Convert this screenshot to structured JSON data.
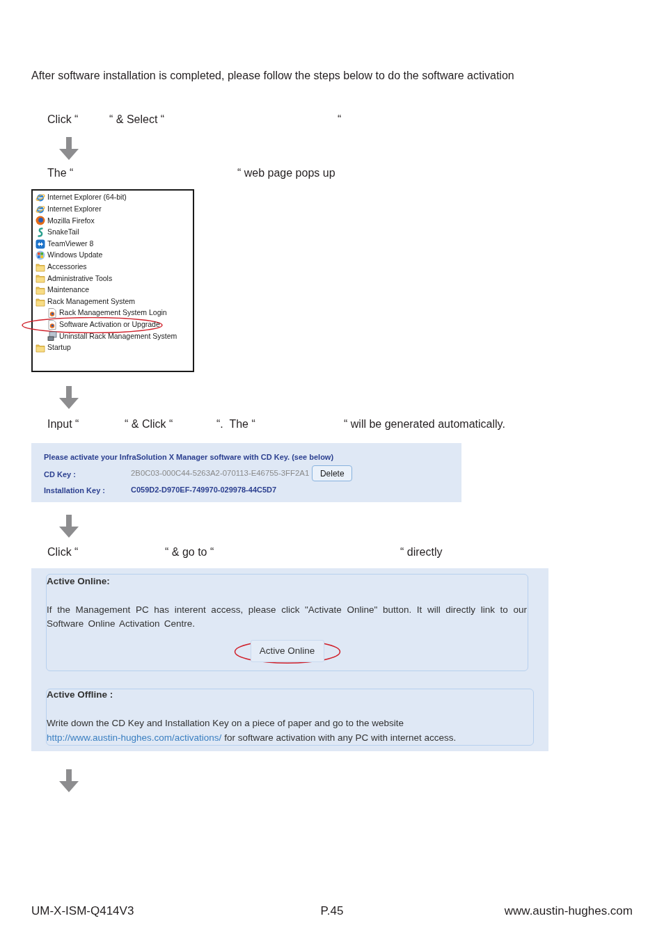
{
  "intro": "After software installation is completed, please follow the steps below to do the software activation",
  "blocks": [
    {
      "kind": "step",
      "parts": [
        "Click “",
        "“ & Select “",
        "“"
      ]
    },
    {
      "kind": "arrow"
    },
    {
      "kind": "step",
      "parts": [
        "The “",
        "“ web page pops up"
      ]
    },
    {
      "kind": "start_menu",
      "items": [
        {
          "label": "Internet Explorer (64-bit)",
          "kind": "program",
          "highlighted": false
        },
        {
          "label": "Internet Explorer",
          "kind": "program",
          "highlighted": false
        },
        {
          "label": "Mozilla Firefox",
          "kind": "program",
          "highlighted": false
        },
        {
          "label": "SnakeTail",
          "kind": "program",
          "highlighted": false
        },
        {
          "label": "TeamViewer 8",
          "kind": "program",
          "highlighted": false
        },
        {
          "label": "Windows Update",
          "kind": "program",
          "highlighted": false
        },
        {
          "label": "Accessories",
          "kind": "folder",
          "highlighted": false
        },
        {
          "label": "Administrative Tools",
          "kind": "folder",
          "highlighted": false
        },
        {
          "label": "Maintenance",
          "kind": "folder",
          "highlighted": false
        },
        {
          "label": "Rack Management System",
          "kind": "folder",
          "highlighted": false,
          "children": [
            {
              "label": "Rack Management System Login",
              "kind": "program",
              "highlighted": false
            },
            {
              "label": "Software Activation or Upgrade",
              "kind": "program",
              "highlighted": true
            },
            {
              "label": "Uninstall Rack Management System",
              "kind": "program",
              "highlighted": false
            }
          ]
        },
        {
          "label": "Startup",
          "kind": "folder",
          "highlighted": false
        }
      ]
    },
    {
      "kind": "arrow"
    },
    {
      "kind": "step",
      "parts": [
        "Input “",
        "“ & Click “",
        "“.  The “",
        "“ will be generated automatically."
      ]
    },
    {
      "kind": "activation_keys",
      "title": "Please activate your InfraSolution X Manager software with CD Key. (see below)",
      "cd_key": {
        "label": "CD Key :",
        "value": "2B0C03-000C44-5263A2-070113-E46755-3FF2A1"
      },
      "delete_button": "Delete",
      "installation_key": {
        "label": "Installation Key :",
        "value": "C059D2-D970EF-749970-029978-44C5D7"
      }
    },
    {
      "kind": "arrow"
    },
    {
      "kind": "step",
      "parts": [
        "Click “",
        "“ & go to “",
        "“ directly"
      ]
    },
    {
      "kind": "activation_methods",
      "online": {
        "heading": "Active Online:",
        "body": "If the Management PC has interent access, please click \"Activate Online\" button. It will directly link to our Software Online Activation Centre.",
        "button": {
          "label": "Active Online",
          "highlighted": true
        }
      },
      "offline": {
        "heading": "Active Offline :",
        "body_before": "Write down the CD Key and Installation Key on a piece of paper and go to the website",
        "link": "http://www.austin-hughes.com/activations/",
        "body_after": "for software activation with any PC with internet access."
      }
    },
    {
      "kind": "arrow"
    }
  ],
  "footer": {
    "doc_code": "UM-X-ISM-Q414V3",
    "page": "P.45",
    "website": "www.austin-hughes.com"
  }
}
